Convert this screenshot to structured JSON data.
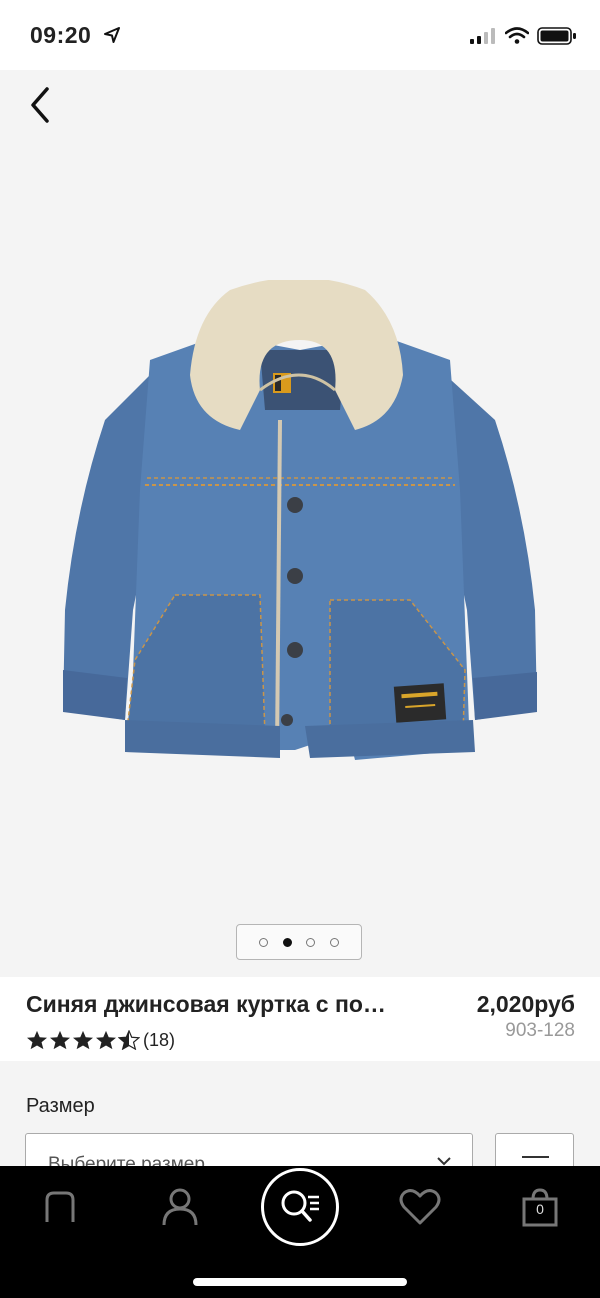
{
  "status_bar": {
    "time": "09:20"
  },
  "product": {
    "title": "Синяя джинсовая куртка с по…",
    "price": "2,020руб",
    "code": "903-128",
    "rating": 4.5,
    "review_count": "(18)",
    "image_count": 4,
    "active_image_index": 1
  },
  "options": {
    "size_label": "Размер",
    "size_placeholder": "Выберите размер"
  },
  "bottom_nav": {
    "items": [
      "home-icon",
      "account-icon",
      "search-icon",
      "favorites-icon",
      "bag-icon"
    ],
    "bag_count": "0"
  }
}
